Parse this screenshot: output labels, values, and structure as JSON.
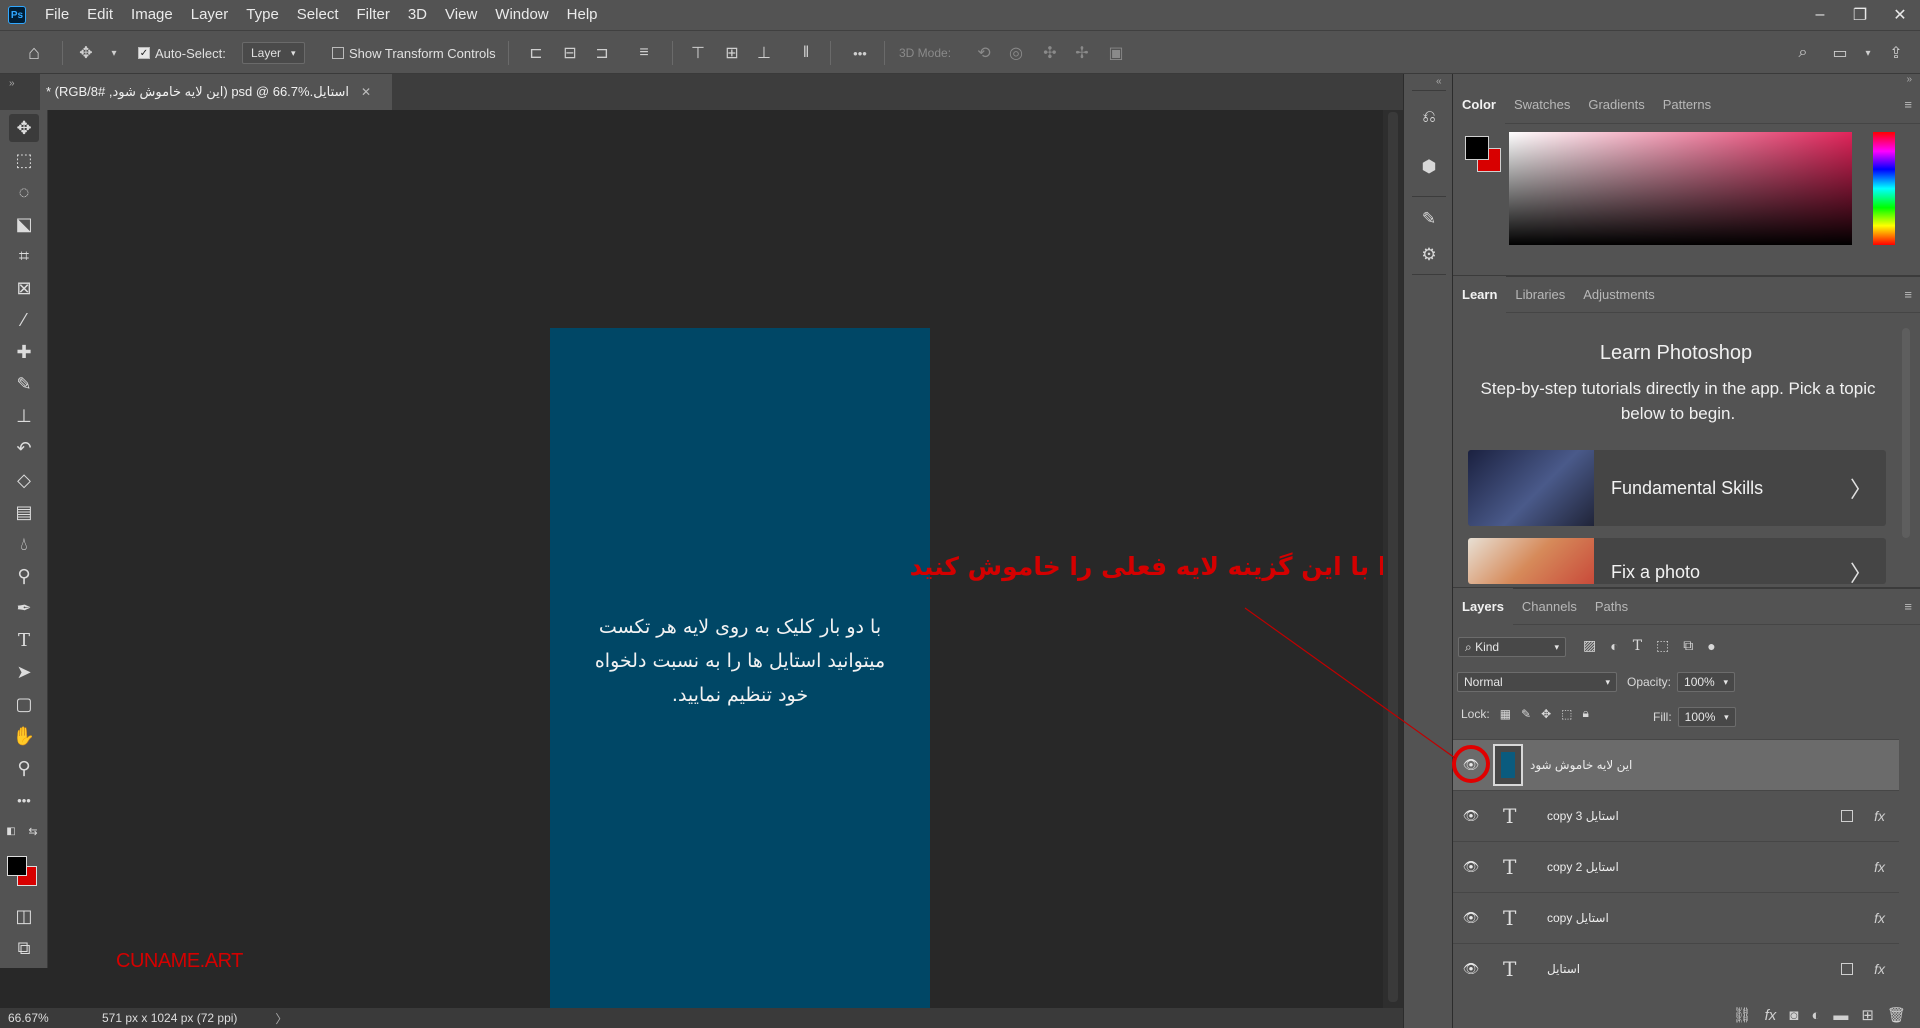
{
  "app": {
    "logo": "Ps",
    "menu": [
      "File",
      "Edit",
      "Image",
      "Layer",
      "Type",
      "Select",
      "Filter",
      "3D",
      "View",
      "Window",
      "Help"
    ],
    "window_controls": [
      "–",
      "❐",
      "✕"
    ]
  },
  "options_bar": {
    "auto_select_label": "Auto-Select:",
    "auto_select_checked": true,
    "auto_select_value": "Layer",
    "show_transform_label": "Show Transform Controls",
    "show_transform_checked": false,
    "more_label": "•••",
    "mode_3d_label": "3D Mode:"
  },
  "document": {
    "tab_title": "استایل.psd @ 66.7% (این لایه خاموش شود, RGB/8#) *",
    "close_label": "✕",
    "zoom": "66.67%",
    "doc_info": "571 px x 1024 px (72 ppi)",
    "doc_info_arrow": "〉",
    "artboard_color": "#004766",
    "artboard_text": [
      "با دو بار کلیک به روی لایه هر تکست",
      "میتوانید استایل ها را به نسبت دلخواه",
      "خود تنظیم نمایید."
    ]
  },
  "annotations": {
    "instruction": "ابتدا با این گزینه لایه فعلی را خاموش کنید",
    "watermark": "CUNAME.ART",
    "annotation_color": "#d40000"
  },
  "tools": [
    "move-tool",
    "marquee-tool",
    "lasso-tool",
    "object-select-tool",
    "crop-tool",
    "frame-tool",
    "eyedropper-tool",
    "healing-brush-tool",
    "brush-tool",
    "clone-stamp-tool",
    "history-brush-tool",
    "eraser-tool",
    "gradient-tool",
    "blur-tool",
    "dodge-tool",
    "pen-tool",
    "type-tool",
    "path-select-tool",
    "shape-tool",
    "hand-tool",
    "zoom-tool",
    "edit-toolbar"
  ],
  "colors": {
    "foreground": "#000000",
    "background": "#d80000"
  },
  "color_panel": {
    "tabs": [
      "Color",
      "Swatches",
      "Gradients",
      "Patterns"
    ],
    "menu_icon": "≡"
  },
  "learn_panel": {
    "tabs": [
      "Learn",
      "Libraries",
      "Adjustments"
    ],
    "title": "Learn Photoshop",
    "description": "Step-by-step tutorials directly in the app. Pick a topic below to begin.",
    "cards": [
      {
        "label": "Fundamental Skills",
        "arrow": "〉"
      },
      {
        "label": "Fix a photo",
        "arrow": "〉"
      }
    ]
  },
  "layers_panel": {
    "tabs": [
      "Layers",
      "Channels",
      "Paths"
    ],
    "filter_label": "Kind",
    "blend_mode": "Normal",
    "opacity_label": "Opacity:",
    "opacity_value": "100%",
    "lock_label": "Lock:",
    "fill_label": "Fill:",
    "fill_value": "100%",
    "layers": [
      {
        "name": "این لایه خاموش شود",
        "type": "pixel",
        "visible": true,
        "selected": true,
        "fx": false,
        "smart": false
      },
      {
        "name": "استایل copy 3",
        "type": "text",
        "visible": true,
        "selected": false,
        "fx": true,
        "smart": true
      },
      {
        "name": "استایل copy 2",
        "type": "text",
        "visible": true,
        "selected": false,
        "fx": true,
        "smart": false
      },
      {
        "name": "استایل copy",
        "type": "text",
        "visible": true,
        "selected": false,
        "fx": true,
        "smart": false
      },
      {
        "name": "استایل",
        "type": "text",
        "visible": true,
        "selected": false,
        "fx": true,
        "smart": true
      }
    ],
    "type_glyph": "T",
    "fx_label": "fx"
  }
}
